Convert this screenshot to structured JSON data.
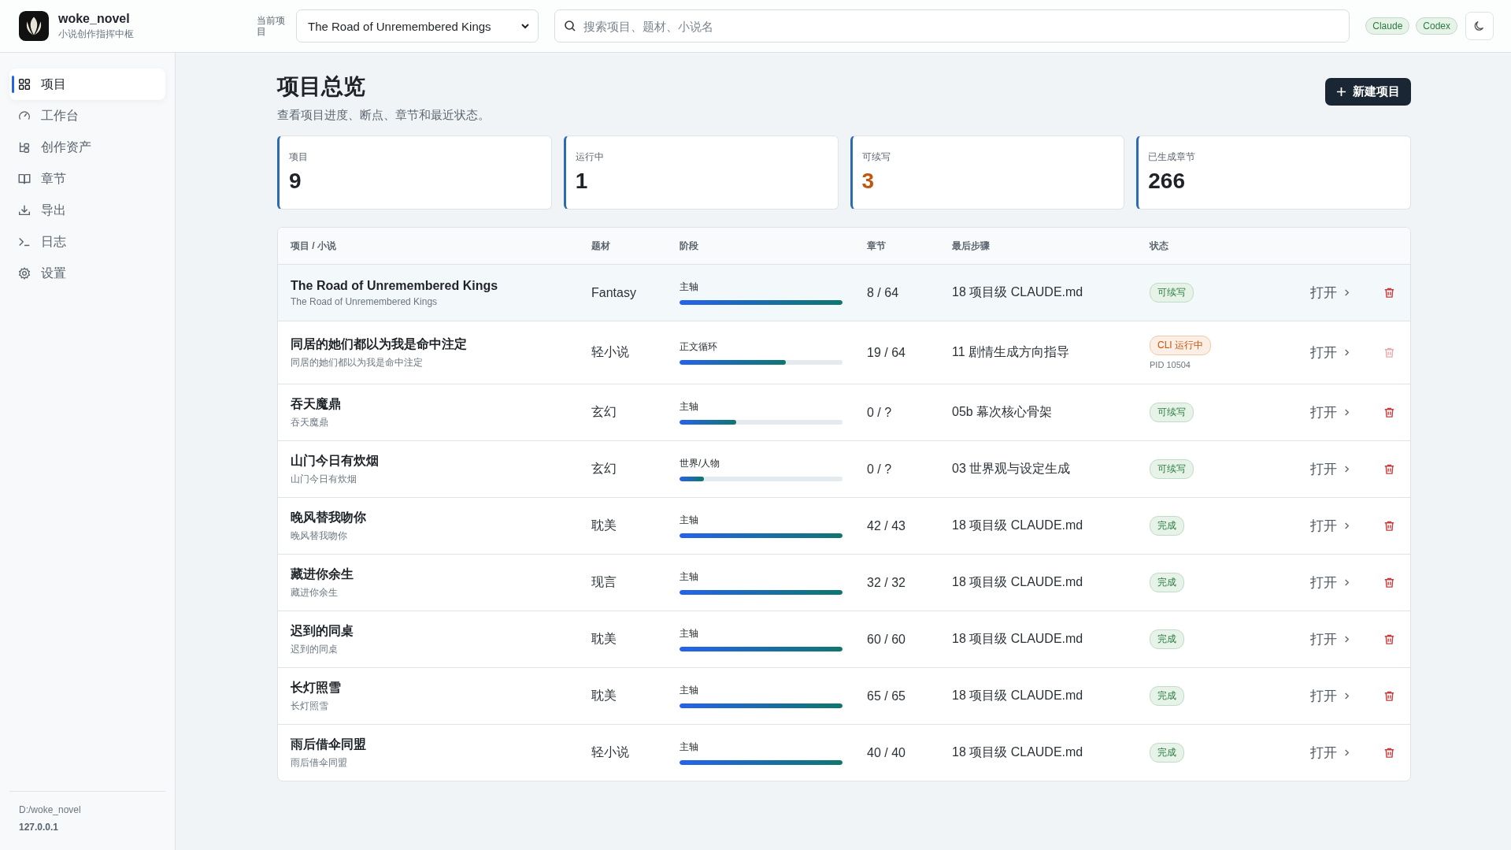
{
  "app": {
    "name": "woke_novel",
    "subtitle": "小说创作指挥中枢"
  },
  "project_select": {
    "label": "当前项目",
    "value": "The Road of Unremembered Kings"
  },
  "search": {
    "placeholder": "搜索项目、题材、小说名"
  },
  "agents": [
    "Claude",
    "Codex"
  ],
  "sidebar": {
    "items": [
      {
        "label": "项目",
        "selected": true
      },
      {
        "label": "工作台",
        "selected": false
      },
      {
        "label": "创作资产",
        "selected": false
      },
      {
        "label": "章节",
        "selected": false
      },
      {
        "label": "导出",
        "selected": false
      },
      {
        "label": "日志",
        "selected": false
      },
      {
        "label": "设置",
        "selected": false
      }
    ],
    "path": "D:/woke_novel",
    "host": "127.0.0.1"
  },
  "page": {
    "title": "项目总览",
    "subtitle": "查看项目进度、断点、章节和最近状态。",
    "new_button": "新建项目"
  },
  "stats": [
    {
      "label": "项目",
      "value": "9",
      "highlight": false
    },
    {
      "label": "运行中",
      "value": "1",
      "highlight": false
    },
    {
      "label": "可续写",
      "value": "3",
      "highlight": true
    },
    {
      "label": "已生成章节",
      "value": "266",
      "highlight": false
    }
  ],
  "table": {
    "columns": [
      "项目 / 小说",
      "题材",
      "阶段",
      "章节",
      "最后步骤",
      "状态"
    ],
    "rows": [
      {
        "title": "The Road of Unremembered Kings",
        "subtitle": "The Road of Unremembered Kings",
        "genre": "Fantasy",
        "stage": "主轴",
        "level": 1.0,
        "chapters": "8 / 64",
        "last_step": "18 项目级 CLAUDE.md",
        "status": {
          "kind": "resumable",
          "label": "可续写"
        },
        "selected": true,
        "delete_disabled": false,
        "open": "打开"
      },
      {
        "title": "同居的她们都以为我是命中注定",
        "subtitle": "同居的她们都以为我是命中注定",
        "genre": "轻小说",
        "stage": "正文循环",
        "level": 0.65,
        "chapters": "19 / 64",
        "last_step": "11 剧情生成方向指导",
        "status": {
          "kind": "running",
          "label": "CLI 运行中",
          "pid": "PID 10504"
        },
        "selected": false,
        "delete_disabled": true,
        "open": "打开"
      },
      {
        "title": "吞天魔鼎",
        "subtitle": "吞天魔鼎",
        "genre": "玄幻",
        "stage": "主轴",
        "level": 0.35,
        "chapters": "0 / ?",
        "last_step": "05b 幕次核心骨架",
        "status": {
          "kind": "resumable",
          "label": "可续写"
        },
        "selected": false,
        "delete_disabled": false,
        "open": "打开"
      },
      {
        "title": "山门今日有炊烟",
        "subtitle": "山门今日有炊烟",
        "genre": "玄幻",
        "stage": "世界/人物",
        "level": 0.15,
        "chapters": "0 / ?",
        "last_step": "03 世界观与设定生成",
        "status": {
          "kind": "resumable",
          "label": "可续写"
        },
        "selected": false,
        "delete_disabled": false,
        "open": "打开"
      },
      {
        "title": "晚风替我吻你",
        "subtitle": "晚风替我吻你",
        "genre": "耽美",
        "stage": "主轴",
        "level": 1.0,
        "chapters": "42 / 43",
        "last_step": "18 项目级 CLAUDE.md",
        "status": {
          "kind": "done",
          "label": "完成"
        },
        "selected": false,
        "delete_disabled": false,
        "open": "打开"
      },
      {
        "title": "藏进你余生",
        "subtitle": "藏进你余生",
        "genre": "现言",
        "stage": "主轴",
        "level": 1.0,
        "chapters": "32 / 32",
        "last_step": "18 项目级 CLAUDE.md",
        "status": {
          "kind": "done",
          "label": "完成"
        },
        "selected": false,
        "delete_disabled": false,
        "open": "打开"
      },
      {
        "title": "迟到的同桌",
        "subtitle": "迟到的同桌",
        "genre": "耽美",
        "stage": "主轴",
        "level": 1.0,
        "chapters": "60 / 60",
        "last_step": "18 项目级 CLAUDE.md",
        "status": {
          "kind": "done",
          "label": "完成"
        },
        "selected": false,
        "delete_disabled": false,
        "open": "打开"
      },
      {
        "title": "长灯照雪",
        "subtitle": "长灯照雪",
        "genre": "耽美",
        "stage": "主轴",
        "level": 1.0,
        "chapters": "65 / 65",
        "last_step": "18 项目级 CLAUDE.md",
        "status": {
          "kind": "done",
          "label": "完成"
        },
        "selected": false,
        "delete_disabled": false,
        "open": "打开"
      },
      {
        "title": "雨后借伞同盟",
        "subtitle": "雨后借伞同盟",
        "genre": "轻小说",
        "stage": "主轴",
        "level": 1.0,
        "chapters": "40 / 40",
        "last_step": "18 项目级 CLAUDE.md",
        "status": {
          "kind": "done",
          "label": "完成"
        },
        "selected": false,
        "delete_disabled": false,
        "open": "打开"
      }
    ]
  }
}
